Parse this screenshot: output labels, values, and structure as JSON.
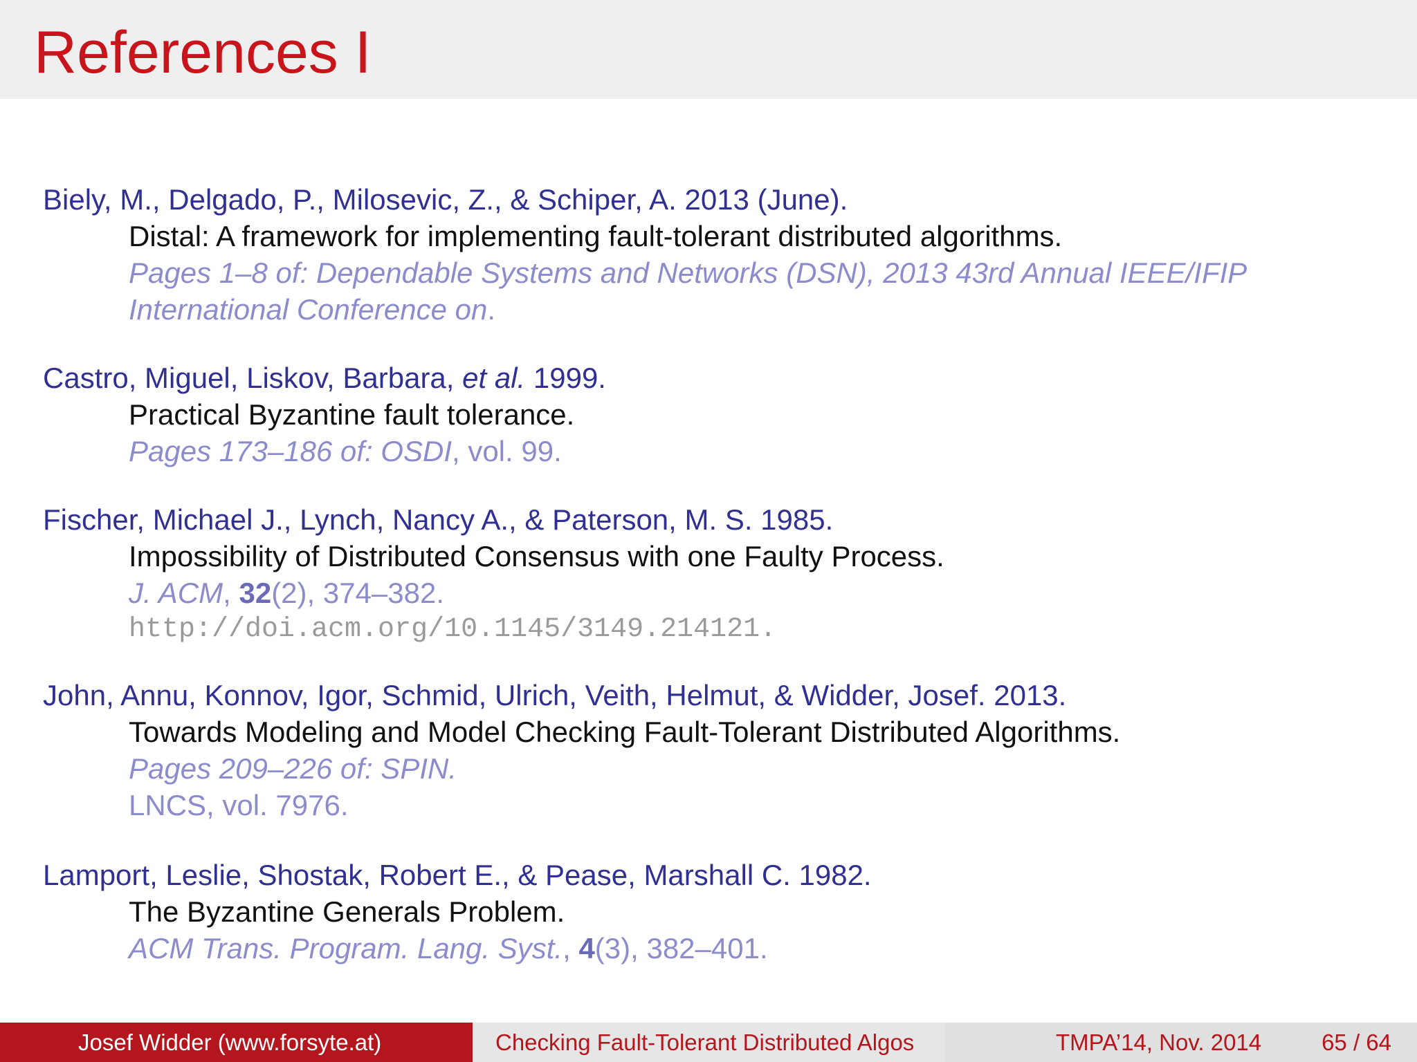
{
  "slide": {
    "title": "References I"
  },
  "references": [
    {
      "authors": "Biely, M., Delgado, P., Milosevic, Z., & Schiper, A. 2013 (June).",
      "title": "Distal: A framework for implementing fault-tolerant distributed algorithms.",
      "venue_line1": "Pages 1–8 of: Dependable Systems and Networks (DSN), 2013 43rd Annual IEEE/IFIP",
      "venue_line2": "International Conference on",
      "venue_line2_end": "."
    },
    {
      "authors_prefix": "Castro, Miguel, Liskov, Barbara, ",
      "authors_etal": "et al.",
      "authors_suffix": " 1999.",
      "title": "Practical Byzantine fault tolerance.",
      "venue": "Pages 173–186 of: OSDI",
      "venue_tail": ", vol. 99."
    },
    {
      "authors": "Fischer, Michael J., Lynch, Nancy A., & Paterson, M. S. 1985.",
      "title": "Impossibility of Distributed Consensus with one Faulty Process.",
      "journal": "J. ACM",
      "journal_sep": ", ",
      "volume": "32",
      "pages": "(2), 374–382.",
      "url": "http://doi.acm.org/10.1145/3149.214121."
    },
    {
      "authors": "John, Annu, Konnov, Igor, Schmid, Ulrich, Veith, Helmut, & Widder, Josef. 2013.",
      "title": "Towards Modeling and Model Checking Fault-Tolerant Distributed Algorithms.",
      "venue": "Pages 209–226 of: SPIN.",
      "series": "LNCS, vol. 7976."
    },
    {
      "authors": "Lamport, Leslie, Shostak, Robert E., & Pease, Marshall C. 1982.",
      "title": "The Byzantine Generals Problem.",
      "journal": "ACM Trans. Program. Lang. Syst.",
      "journal_sep": ", ",
      "volume": "4",
      "pages": "(3), 382–401."
    }
  ],
  "footer": {
    "author": "Josef Widder  (www.forsyte.at)",
    "talk_title": "Checking Fault-Tolerant Distributed Algos",
    "event": "TMPA’14, Nov. 2014",
    "page": "65 / 64"
  },
  "colors": {
    "title_red": "#c8151b",
    "author_blue": "#303092",
    "venue_light_blue": "#8c8ccc",
    "footer_red": "#b3161d",
    "header_gray": "#efefef"
  }
}
